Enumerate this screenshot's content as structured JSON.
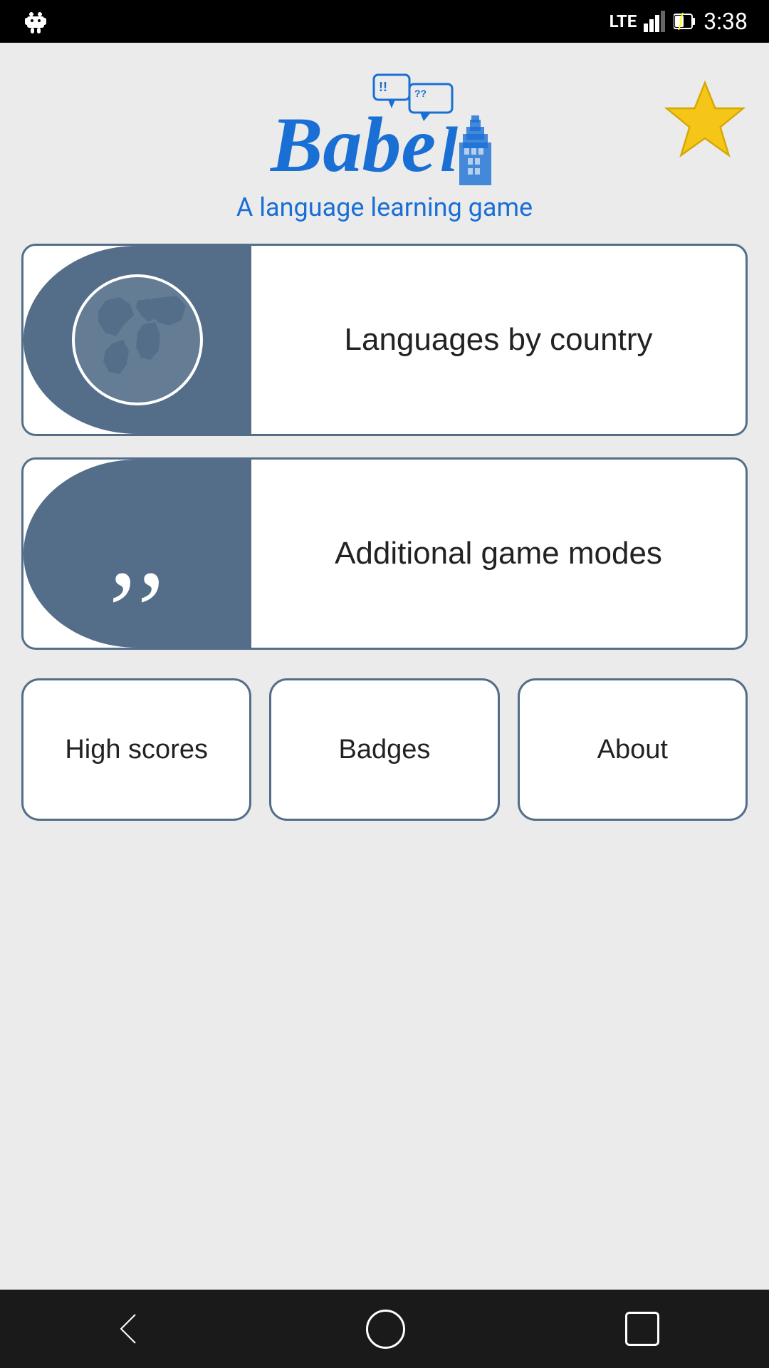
{
  "status": {
    "time": "3:38",
    "lte": "LTE",
    "android_icon": "android-icon"
  },
  "header": {
    "subtitle": "A language learning game",
    "star_label": "star"
  },
  "game_buttons": [
    {
      "id": "languages-by-country",
      "label": "Languages by country",
      "icon": "globe-icon"
    },
    {
      "id": "additional-game-modes",
      "label": "Additional game modes",
      "icon": "quote-icon"
    }
  ],
  "bottom_buttons": [
    {
      "id": "high-scores",
      "label": "High scores"
    },
    {
      "id": "badges",
      "label": "Badges"
    },
    {
      "id": "about",
      "label": "About"
    }
  ],
  "colors": {
    "accent": "#546e8a",
    "blue_text": "#1a6fd4",
    "star_yellow": "#f5c518"
  }
}
